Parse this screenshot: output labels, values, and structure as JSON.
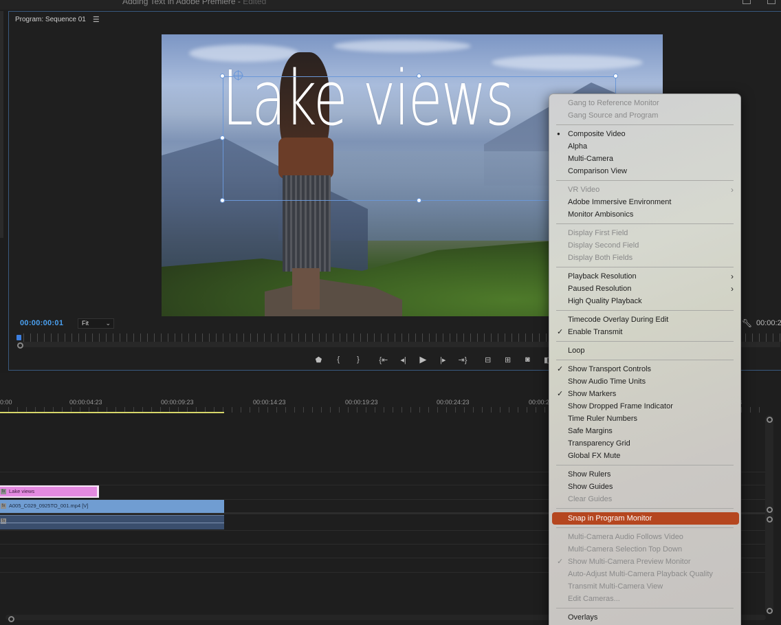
{
  "window": {
    "title": "Adding Text in Adobe Premiere",
    "status": "Edited"
  },
  "program_monitor": {
    "title": "Program: Sequence 01",
    "menu_icon": "hamburger-icon",
    "overlay_text": "Lake views",
    "timecode": "00:00:00:01",
    "fit_value": "Fit",
    "timecode_right": "00:00:2",
    "transport_icons": [
      "add-marker-icon",
      "mark-in-icon",
      "mark-out-icon",
      "go-to-in-icon",
      "step-back-icon",
      "play-icon",
      "step-forward-icon",
      "go-to-out-icon",
      "lift-icon",
      "extract-icon",
      "export-frame-icon",
      "comparison-view-icon"
    ],
    "transport_glyphs": [
      "⬟",
      "{",
      "}",
      "{⇤",
      "◂|",
      "▶",
      "|▸",
      "⇥}",
      "⊟",
      "⊞",
      "◙",
      "◧"
    ]
  },
  "timeline": {
    "ruler_labels": [
      "0:00",
      "00:00:04:23",
      "00:00:09:23",
      "00:00:14:23",
      "00:00:19:23",
      "00:00:24:23",
      "00:00:2",
      "3"
    ],
    "clips": {
      "title_clip": "Lake views",
      "video_clip": "A005_C029_0925TO_001.mp4 [V]",
      "fx_badge": "fx"
    },
    "colors": {
      "title_clip": "#e48ae0",
      "video_clip": "#709dd2",
      "audio_clip": "#3a4e6d",
      "work_area": "#d7d76a",
      "playhead": "#3d7fe0"
    }
  },
  "context_menu": {
    "highlight_color": "#b5461f",
    "items": [
      {
        "label": "Gang to Reference Monitor",
        "disabled": true
      },
      {
        "label": "Gang Source and Program",
        "disabled": true
      },
      {
        "label": "Composite Video",
        "mark": "bullet"
      },
      {
        "label": "Alpha"
      },
      {
        "label": "Multi-Camera"
      },
      {
        "label": "Comparison View"
      },
      {
        "label": "VR Video",
        "disabled": true,
        "submenu": true
      },
      {
        "label": "Adobe Immersive Environment"
      },
      {
        "label": "Monitor Ambisonics"
      },
      {
        "label": "Display First Field",
        "disabled": true
      },
      {
        "label": "Display Second Field",
        "disabled": true
      },
      {
        "label": "Display Both Fields",
        "disabled": true
      },
      {
        "label": "Playback Resolution",
        "submenu": true
      },
      {
        "label": "Paused Resolution",
        "submenu": true
      },
      {
        "label": "High Quality Playback"
      },
      {
        "label": "Timecode Overlay During Edit"
      },
      {
        "label": "Enable Transmit",
        "mark": "check"
      },
      {
        "label": "Loop"
      },
      {
        "label": "Show Transport Controls",
        "mark": "check"
      },
      {
        "label": "Show Audio Time Units"
      },
      {
        "label": "Show Markers",
        "mark": "check"
      },
      {
        "label": "Show Dropped Frame Indicator"
      },
      {
        "label": "Time Ruler Numbers"
      },
      {
        "label": "Safe Margins"
      },
      {
        "label": "Transparency Grid"
      },
      {
        "label": "Global FX Mute"
      },
      {
        "label": "Show Rulers"
      },
      {
        "label": "Show Guides"
      },
      {
        "label": "Clear Guides",
        "disabled": true
      },
      {
        "label": "Snap in Program Monitor",
        "highlighted": true
      },
      {
        "label": "Multi-Camera Audio Follows Video",
        "disabled": true
      },
      {
        "label": "Multi-Camera Selection Top Down",
        "disabled": true
      },
      {
        "label": "Show Multi-Camera Preview Monitor",
        "disabled": true,
        "mark": "check"
      },
      {
        "label": "Auto-Adjust Multi-Camera Playback Quality",
        "disabled": true
      },
      {
        "label": "Transmit Multi-Camera View",
        "disabled": true
      },
      {
        "label": "Edit Cameras...",
        "disabled": true
      },
      {
        "label": "Overlays"
      }
    ],
    "mark_glyphs": {
      "bullet": "●",
      "check": "✓"
    },
    "submenu_glyph": "›"
  }
}
